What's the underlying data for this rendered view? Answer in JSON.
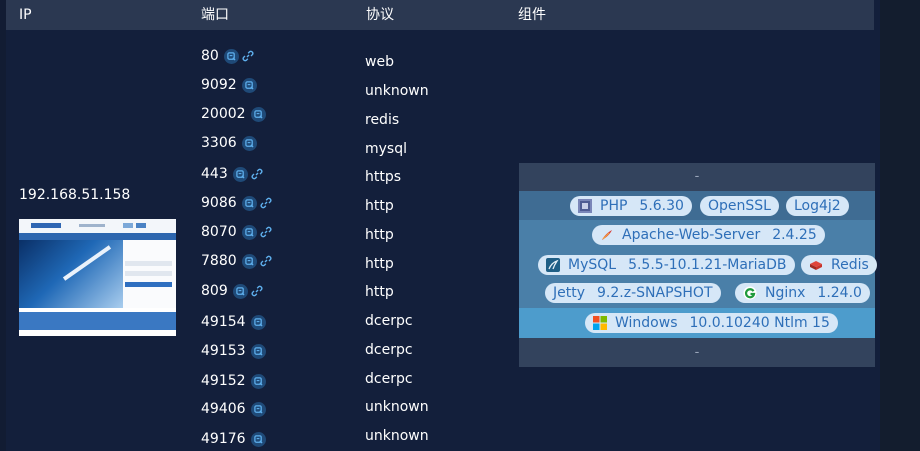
{
  "header": {
    "ip": "IP",
    "port": "端口",
    "protocol": "协议",
    "component": "组件"
  },
  "host": {
    "ip": "192.168.51.158"
  },
  "ports": [
    {
      "port": "80",
      "protocol": "web",
      "link": true
    },
    {
      "port": "9092",
      "protocol": "unknown",
      "link": false
    },
    {
      "port": "20002",
      "protocol": "redis",
      "link": false
    },
    {
      "port": "3306",
      "protocol": "mysql",
      "link": false
    },
    {
      "port": "443",
      "protocol": "https",
      "link": true
    },
    {
      "port": "9086",
      "protocol": "http",
      "link": true
    },
    {
      "port": "8070",
      "protocol": "http",
      "link": true
    },
    {
      "port": "7880",
      "protocol": "http",
      "link": true
    },
    {
      "port": "809",
      "protocol": "http",
      "link": true
    },
    {
      "port": "49154",
      "protocol": "dcerpc",
      "link": false
    },
    {
      "port": "49153",
      "protocol": "dcerpc",
      "link": false
    },
    {
      "port": "49152",
      "protocol": "dcerpc",
      "link": false
    },
    {
      "port": "49406",
      "protocol": "unknown",
      "link": false
    },
    {
      "port": "49176",
      "protocol": "unknown",
      "link": false
    }
  ],
  "components": {
    "top_dash": "-",
    "bottom_dash": "-",
    "php": {
      "name": "PHP",
      "version": "5.6.30"
    },
    "openssl": {
      "name": "OpenSSL"
    },
    "log4j2": {
      "name": "Log4j2"
    },
    "apache": {
      "name": "Apache-Web-Server",
      "version": "2.4.25"
    },
    "mysql": {
      "name": "MySQL",
      "version": "5.5.5-10.1.21-MariaDB"
    },
    "redis": {
      "name": "Redis"
    },
    "jetty": {
      "name": "Jetty",
      "version": "9.2.z-SNAPSHOT"
    },
    "nginx": {
      "name": "Nginx",
      "version": "1.24.0"
    },
    "windows": {
      "name": "Windows",
      "version": "10.0.10240 Ntlm 15"
    }
  },
  "colors": {
    "page_bg": "#121c33",
    "header_bg": "#2b3851",
    "pill_bg": "#d6e7f7",
    "pill_text": "#2e6fb8",
    "band_middleware": "#4a7fa8",
    "band_os": "#4d9ccc"
  },
  "icons": {
    "port_detail": "fingerprint-report-icon",
    "port_link": "external-link-icon"
  }
}
